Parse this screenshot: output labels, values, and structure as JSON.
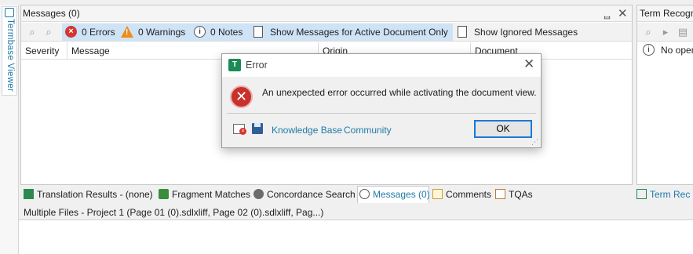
{
  "left_strip": {
    "tab_label": "Termbase Viewer"
  },
  "messages_panel": {
    "title": "Messages (0)",
    "pin_glyph": "ᆸ",
    "close_glyph": "✕",
    "toolbar": {
      "errors": "0 Errors",
      "warnings": "0 Warnings",
      "notes": "0 Notes",
      "active_doc_only": "Show Messages for Active Document Only",
      "show_ignored": "Show Ignored Messages"
    },
    "columns": [
      "Severity",
      "Message",
      "Origin",
      "Document"
    ]
  },
  "term_panel": {
    "title": "Term Recogn",
    "info_text": "No open"
  },
  "bottom_tabs": [
    {
      "label": "Translation Results - (none)",
      "icon": "translation-results-icon"
    },
    {
      "label": "Fragment Matches",
      "icon": "fragment-matches-icon"
    },
    {
      "label": "Concordance Search",
      "icon": "concordance-search-icon"
    },
    {
      "label": "Messages (0)",
      "icon": "messages-icon",
      "active": true
    },
    {
      "label": "Comments",
      "icon": "comments-icon"
    },
    {
      "label": "TQAs",
      "icon": "tqa-icon"
    }
  ],
  "term_rec_tab": "Term Rec",
  "status_line": "Multiple Files - Project 1 (Page 01 (0).sdlxliff, Page 02 (0).sdlxliff, Pag...)",
  "dialog": {
    "title": "Error",
    "message": "An unexpected error occurred while activating the document view.",
    "knowledge_base": "Knowledge Base",
    "community": "Community",
    "ok": "OK"
  },
  "colors": {
    "accent": "#1f7aa6",
    "error": "#d3372f",
    "warning": "#ef8a1c",
    "selection": "#cfe3f6"
  }
}
